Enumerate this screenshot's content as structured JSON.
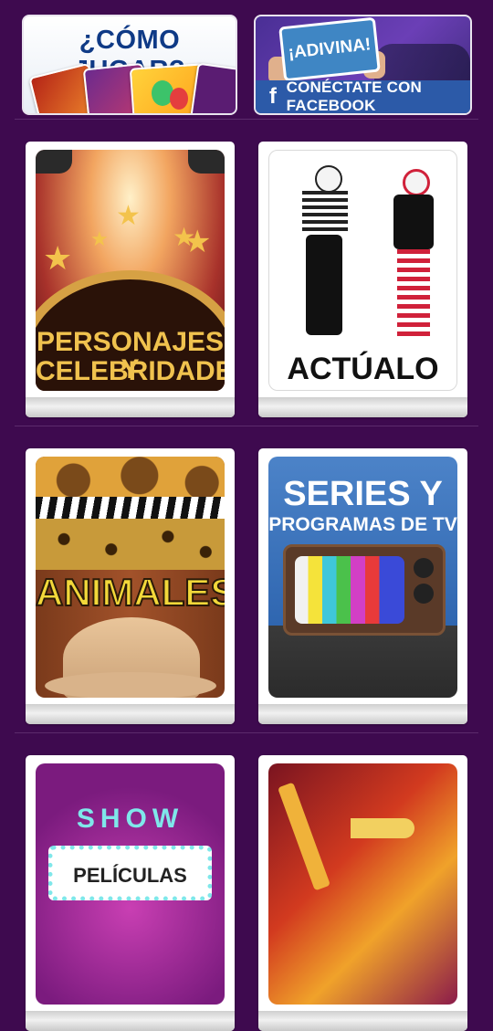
{
  "how_to_play": {
    "title": "¿CÓMO JUGAR?"
  },
  "facebook": {
    "card_text": "¡ADIVINA!",
    "connect_label": "CONÉCTATE CON FACEBOOK",
    "logo": "f"
  },
  "categories": [
    {
      "label": "PERSONAJES Y CELEBRIDADES",
      "line1": "PERSONAJES Y",
      "line2": "CELEBRIDADES"
    },
    {
      "label": "ACTÚALO"
    },
    {
      "label": "ANIMALES"
    },
    {
      "title": "SERIES Y",
      "subtitle": "PROGRAMAS DE TV"
    },
    {
      "marquee": "SHOW",
      "sign": "PELÍCULAS"
    },
    {
      "label": ""
    }
  ],
  "colors": {
    "background": "#3e0a4f",
    "facebook": "#2c5aa8",
    "accent_gold": "#f3c34c"
  },
  "icons": {
    "facebook": "facebook-icon"
  }
}
